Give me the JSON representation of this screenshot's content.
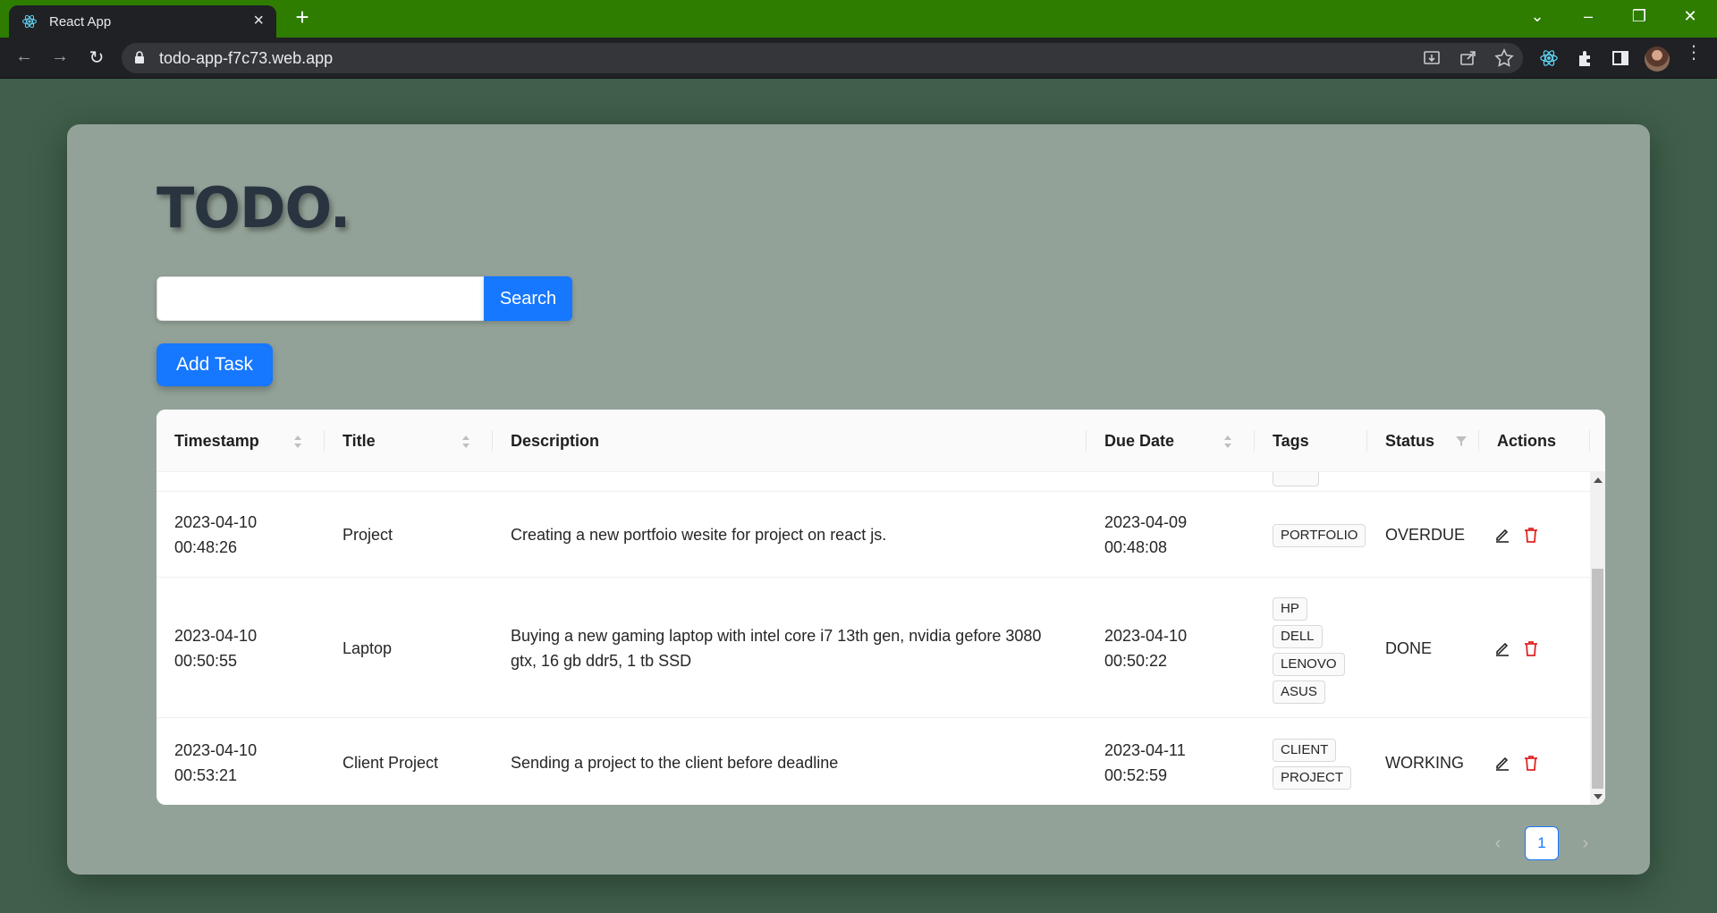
{
  "browser": {
    "tab_title": "React App",
    "url": "todo-app-f7c73.web.app"
  },
  "app": {
    "title": "TODO.",
    "search": {
      "value": "",
      "placeholder": "",
      "button_label": "Search"
    },
    "add_task_label": "Add Task"
  },
  "table": {
    "columns": [
      "Timestamp",
      "Title",
      "Description",
      "Due Date",
      "Tags",
      "Status",
      "Actions"
    ],
    "rows": [
      {
        "timestamp": [
          "2023-04-10",
          "00:48:26"
        ],
        "title": "Project",
        "description": "Creating a new portfoio wesite for project on react js.",
        "due_date": [
          "2023-04-09",
          "00:48:08"
        ],
        "tags": [
          "PORTFOLIO"
        ],
        "status": "OVERDUE"
      },
      {
        "timestamp": [
          "2023-04-10",
          "00:50:55"
        ],
        "title": "Laptop",
        "description": "Buying a new gaming laptop with intel core i7 13th gen, nvidia gefore 3080 gtx, 16 gb ddr5, 1 tb SSD",
        "due_date": [
          "2023-04-10",
          "00:50:22"
        ],
        "tags": [
          "HP",
          "DELL",
          "LENOVO",
          "ASUS"
        ],
        "status": "DONE"
      },
      {
        "timestamp": [
          "2023-04-10",
          "00:53:21"
        ],
        "title": "Client Project",
        "description": "Sending a project to the client before deadline",
        "due_date": [
          "2023-04-11",
          "00:52:59"
        ],
        "tags": [
          "CLIENT",
          "PROJECT"
        ],
        "status": "WORKING"
      }
    ]
  },
  "pagination": {
    "current_page": "1"
  },
  "colors": {
    "primary": "#1677ff",
    "delete": "#e02424",
    "tab_bar": "#2e7d00",
    "card": "#93a298",
    "page_bg": "#3f5f4a"
  }
}
